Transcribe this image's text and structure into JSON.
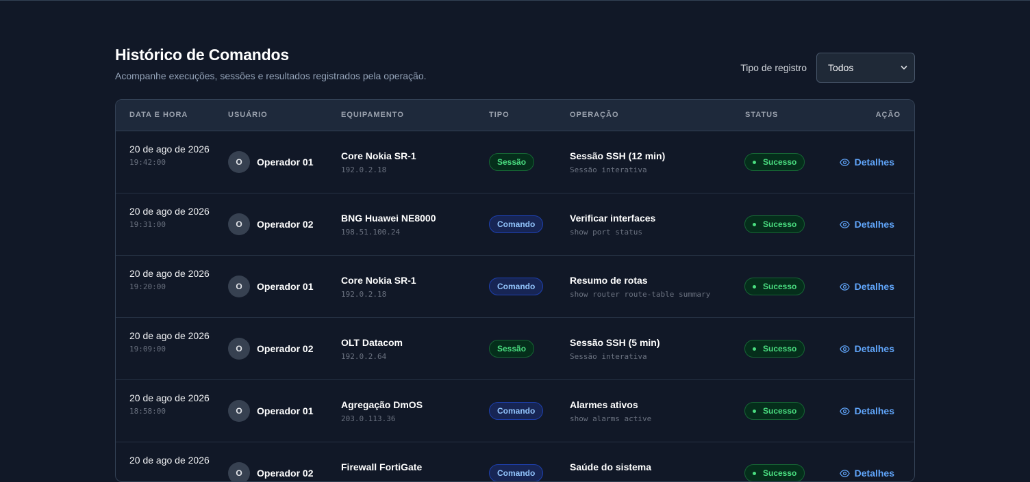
{
  "header": {
    "title": "Histórico de Comandos",
    "subtitle": "Acompanhe execuções, sessões e resultados registrados pela operação."
  },
  "filter": {
    "label": "Tipo de registro",
    "selected": "Todos",
    "icon": "chevron-down-icon"
  },
  "table": {
    "columns": [
      "DATA E HORA",
      "USUÁRIO",
      "EQUIPAMENTO",
      "TIPO",
      "OPERAÇÃO",
      "STATUS",
      "AÇÃO"
    ],
    "action_label": "Detalhes",
    "rows": [
      {
        "date": "20 de ago de 2026",
        "time": "19:42:00",
        "avatar": "O",
        "user": "Operador 01",
        "device": "Core Nokia SR-1",
        "ip": "192.0.2.18",
        "type": "Sessão",
        "type_kind": "sessao",
        "operation": "Sessão SSH (12 min)",
        "detail": "Sessão interativa",
        "status": "Sucesso"
      },
      {
        "date": "20 de ago de 2026",
        "time": "19:31:00",
        "avatar": "O",
        "user": "Operador 02",
        "device": "BNG Huawei NE8000",
        "ip": "198.51.100.24",
        "type": "Comando",
        "type_kind": "comando",
        "operation": "Verificar interfaces",
        "detail": "show port status",
        "status": "Sucesso"
      },
      {
        "date": "20 de ago de 2026",
        "time": "19:20:00",
        "avatar": "O",
        "user": "Operador 01",
        "device": "Core Nokia SR-1",
        "ip": "192.0.2.18",
        "type": "Comando",
        "type_kind": "comando",
        "operation": "Resumo de rotas",
        "detail": "show router route-table summary",
        "status": "Sucesso"
      },
      {
        "date": "20 de ago de 2026",
        "time": "19:09:00",
        "avatar": "O",
        "user": "Operador 02",
        "device": "OLT Datacom",
        "ip": "192.0.2.64",
        "type": "Sessão",
        "type_kind": "sessao",
        "operation": "Sessão SSH (5 min)",
        "detail": "Sessão interativa",
        "status": "Sucesso"
      },
      {
        "date": "20 de ago de 2026",
        "time": "18:58:00",
        "avatar": "O",
        "user": "Operador 01",
        "device": "Agregação DmOS",
        "ip": "203.0.113.36",
        "type": "Comando",
        "type_kind": "comando",
        "operation": "Alarmes ativos",
        "detail": "show alarms active",
        "status": "Sucesso"
      },
      {
        "date": "20 de ago de 2026",
        "time": "",
        "avatar": "O",
        "user": "Operador 02",
        "device": "Firewall FortiGate",
        "ip": "",
        "type": "Comando",
        "type_kind": "comando",
        "operation": "Saúde do sistema",
        "detail": "",
        "status": "Sucesso"
      }
    ]
  },
  "colors": {
    "background": "#111827",
    "accent": "#60a5fa",
    "success": "#4ade80"
  }
}
